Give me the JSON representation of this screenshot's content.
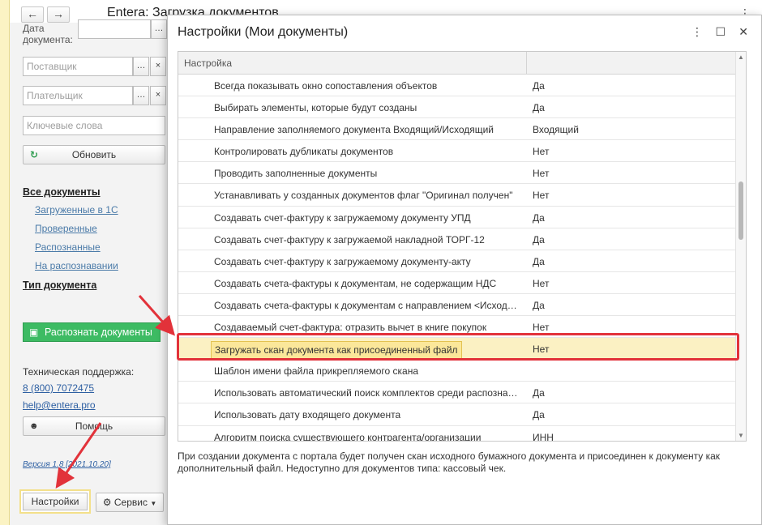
{
  "window": {
    "title": "Entera: Загрузка документов",
    "back_icon": "arrow-left-icon",
    "forward_icon": "arrow-right-icon"
  },
  "sidebar": {
    "date_label": "Дата документа:",
    "supplier_placeholder": "Поставщик",
    "payer_placeholder": "Плательщик",
    "keywords_placeholder": "Ключевые слова",
    "refresh_label": "Обновить",
    "all_docs_label": "Все документы",
    "links": [
      "Загруженные в 1С",
      "Проверенные",
      "Распознанные",
      "На распознавании"
    ],
    "doc_type_label": "Тип документа",
    "recognize_label": "Распознать документы",
    "support_label": "Техническая поддержка:",
    "phone": "8 (800) 7072475",
    "email": "help@entera.pro",
    "help_label": "Помощь",
    "version": "Версия 1.8 [2021.10.20]",
    "settings_label": "Настройки",
    "service_label": "Сервис"
  },
  "dialog": {
    "title": "Настройки (Мои документы)",
    "column_header": "Настройка",
    "rows": [
      {
        "name": "Всегда показывать окно сопоставления объектов",
        "value": "Да"
      },
      {
        "name": "Выбирать элементы, которые будут созданы",
        "value": "Да"
      },
      {
        "name": "Направление заполняемого документа Входящий/Исходящий",
        "value": "Входящий"
      },
      {
        "name": "Контролировать дубликаты документов",
        "value": "Нет"
      },
      {
        "name": "Проводить заполненные документы",
        "value": "Нет"
      },
      {
        "name": "Устанавливать у созданных документов флаг \"Оригинал получен\"",
        "value": "Нет"
      },
      {
        "name": "Создавать счет-фактуру к загружаемому документу УПД",
        "value": "Да"
      },
      {
        "name": "Создавать счет-фактуру к загружаемой накладной ТОРГ-12",
        "value": "Да"
      },
      {
        "name": "Создавать счет-фактуру к загружаемому документу-акту",
        "value": "Да"
      },
      {
        "name": "Создавать счета-фактуры к документам, не содержащим НДС",
        "value": "Нет"
      },
      {
        "name": "Создавать счета-фактуры к документам с направлением <Исход…",
        "value": "Да"
      },
      {
        "name": "Создаваемый счет-фактура: отразить вычет в книге покупок",
        "value": "Нет"
      },
      {
        "name": "Загружать скан документа как присоединенный файл",
        "value": "Нет"
      },
      {
        "name": "Шаблон имени файла прикрепляемого скана",
        "value": ""
      },
      {
        "name": "Использовать автоматический поиск комплектов среди распозна…",
        "value": "Да"
      },
      {
        "name": "Использовать дату входящего документа",
        "value": "Да"
      },
      {
        "name": "Алгоритм поиска существующего контрагента/организации",
        "value": "ИНН"
      }
    ],
    "selected_index": 12,
    "description": "При создании документа с портала будет получен скан исходного бумажного документа и присоединен к документу как дополнительный файл. Недоступно для документов типа: кассовый чек.",
    "highlight_color": "#e2323a",
    "arrow_color": "#e2323a"
  }
}
